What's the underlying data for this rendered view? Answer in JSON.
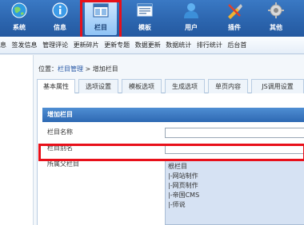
{
  "toolbar": {
    "items": [
      {
        "label": "系统",
        "icon": "globe-icon"
      },
      {
        "label": "信息",
        "icon": "info-icon"
      },
      {
        "label": "栏目",
        "icon": "column-icon"
      },
      {
        "label": "模板",
        "icon": "template-icon"
      },
      {
        "label": "用户",
        "icon": "user-icon"
      },
      {
        "label": "插件",
        "icon": "plugin-icon"
      },
      {
        "label": "其他",
        "icon": "gear-icon"
      }
    ],
    "active": "栏目"
  },
  "submenu": [
    "息",
    "签发信息",
    "管理评论",
    "更新碎片",
    "更新专题",
    "数据更新",
    "数据统计",
    "排行统计",
    "后台首"
  ],
  "breadcrumb": {
    "prefix": "位置：",
    "link": "栏目管理",
    "separator": " > ",
    "current": "增加栏目"
  },
  "tabs": [
    "基本属性",
    "选项设置",
    "模板选项",
    "生成选项",
    "单页内容",
    "JS调用设置"
  ],
  "panel": {
    "heading": "增加栏目",
    "fields": [
      {
        "label": "栏目名称",
        "value": ""
      },
      {
        "label": "栏目别名",
        "value": ""
      },
      {
        "label": "所属父栏目"
      }
    ],
    "parent_options": [
      "根栏目",
      "|-网站制作",
      "|-网页制作",
      "|-帝国CMS",
      "|-师说"
    ]
  }
}
